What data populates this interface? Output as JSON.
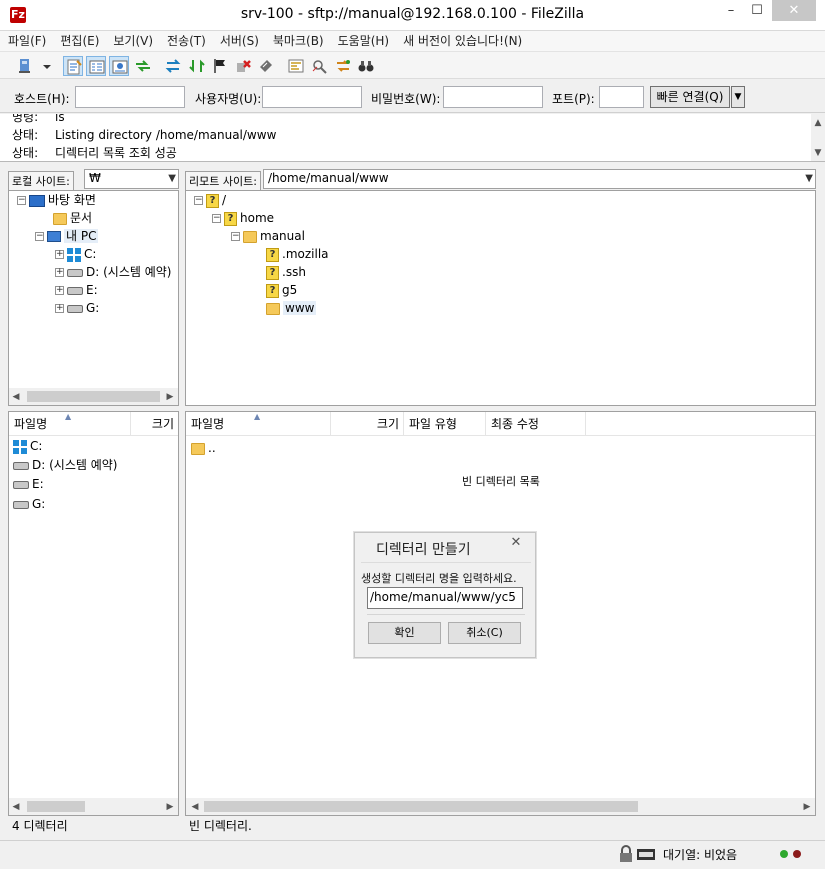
{
  "window": {
    "title": "srv-100 - sftp://manual@192.168.0.100 - FileZilla",
    "app_icon": "Fz",
    "minimize": "–",
    "maximize": "☐",
    "close": "✕"
  },
  "menu": [
    "파일(F)",
    "편집(E)",
    "보기(V)",
    "전송(T)",
    "서버(S)",
    "북마크(B)",
    "도움말(H)",
    "새 버전이 있습니다!(N)"
  ],
  "toolbar": {
    "icons": [
      "site-manager-icon",
      "dropdown-arrow-icon",
      "toggle-log-icon",
      "toggle-local-tree-icon",
      "toggle-remote-tree-icon",
      "toggle-queue-icon",
      "refresh-icon",
      "process-queue-icon",
      "cancel-icon",
      "disconnect-icon",
      "reconnect-icon",
      "filter-icon",
      "compare-icon",
      "sync-browse-icon",
      "search-icon"
    ]
  },
  "quickconnect": {
    "host_label": "호스트(H):",
    "user_label": "사용자명(U):",
    "pass_label": "비밀번호(W):",
    "port_label": "포트(P):",
    "host_value": "",
    "user_value": "",
    "pass_value": "",
    "port_value": "",
    "connect_button": "빠른 연결(Q)",
    "dropdown": "▼"
  },
  "log": [
    {
      "label": "명령:",
      "text": "ls"
    },
    {
      "label": "상태:",
      "text": "Listing directory /home/manual/www"
    },
    {
      "label": "상태:",
      "text": "디렉터리 목록 조회 성공"
    }
  ],
  "local": {
    "site_label": "로컬 사이트:",
    "site_path": "₩",
    "tree": [
      {
        "label": "바탕 화면",
        "icon": "desktop-icon",
        "expander": "−"
      },
      {
        "label": "문서",
        "icon": "folder-icon",
        "expander": ""
      },
      {
        "label": "내 PC",
        "icon": "computer-icon",
        "expander": "−"
      },
      {
        "label": "C:",
        "icon": "windows-drive-icon",
        "expander": "+"
      },
      {
        "label": "D: (시스템 예약)",
        "icon": "drive-icon",
        "expander": "+"
      },
      {
        "label": "E:",
        "icon": "drive-icon",
        "expander": "+"
      },
      {
        "label": "G:",
        "icon": "drive-icon",
        "expander": "+"
      }
    ],
    "columns": [
      "파일명",
      "크기"
    ],
    "files": [
      {
        "name": "C:",
        "icon": "windows-drive-icon"
      },
      {
        "name": "D: (시스템 예약)",
        "icon": "drive-icon"
      },
      {
        "name": "E:",
        "icon": "drive-icon"
      },
      {
        "name": "G:",
        "icon": "drive-icon"
      }
    ],
    "status": "4 디렉터리"
  },
  "remote": {
    "site_label": "리모트 사이트:",
    "site_path": "/home/manual/www",
    "tree": [
      {
        "label": "/",
        "icon": "unknown-folder-icon",
        "expander": "−"
      },
      {
        "label": "home",
        "icon": "unknown-folder-icon",
        "expander": "−"
      },
      {
        "label": "manual",
        "icon": "folder-icon",
        "expander": "−"
      },
      {
        "label": ".mozilla",
        "icon": "unknown-folder-icon",
        "expander": ""
      },
      {
        "label": ".ssh",
        "icon": "unknown-folder-icon",
        "expander": ""
      },
      {
        "label": "g5",
        "icon": "unknown-folder-icon",
        "expander": ""
      },
      {
        "label": "www",
        "icon": "folder-icon",
        "expander": ""
      }
    ],
    "columns": [
      "파일명",
      "크기",
      "파일 유형",
      "최종 수정"
    ],
    "files": [
      {
        "name": "..",
        "icon": "folder-icon"
      }
    ],
    "empty_message": "빈 디렉터리 목록",
    "status": "빈 디렉터리."
  },
  "dialog": {
    "title": "디렉터리 만들기",
    "close": "✕",
    "prompt": "생성할 디렉터리 명을 입력하세요.",
    "input_value": "/home/manual/www/yc5",
    "ok_button": "확인",
    "cancel_button": "취소(C)"
  },
  "statusbar": {
    "queue_text": "대기열: 비었음",
    "led_colors": [
      "#2ea82e",
      "#8b1a1a"
    ]
  }
}
